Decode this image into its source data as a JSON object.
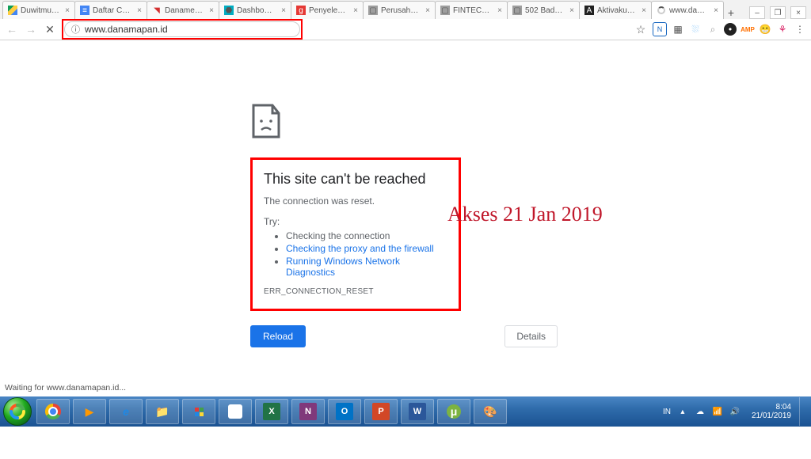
{
  "tabs": [
    {
      "title": "Duwitmu draf"
    },
    {
      "title": "Daftar Call Ce"
    },
    {
      "title": "Danamerdeka"
    },
    {
      "title": "Dashboard - A"
    },
    {
      "title": "Penyelenggar"
    },
    {
      "title": "Perusahaan Fi"
    },
    {
      "title": "FINTECH INDO"
    },
    {
      "title": "502 Bad Gate"
    },
    {
      "title": "Aktivaku Akti"
    },
    {
      "title": "www.danama"
    }
  ],
  "address_url": "www.danamapan.id",
  "error": {
    "heading": "This site can't be reached",
    "subtitle": "The connection was reset.",
    "try_label": "Try:",
    "items": {
      "check_conn": "Checking the connection",
      "check_proxy": "Checking the proxy and the firewall",
      "run_diag": "Running Windows Network Diagnostics"
    },
    "code": "ERR_CONNECTION_RESET",
    "reload": "Reload",
    "details": "Details"
  },
  "annotation": "Akses 21 Jan 2019",
  "status_bar": "Waiting for www.danamapan.id...",
  "tray": {
    "lang": "IN",
    "time": "8:04",
    "date": "21/01/2019"
  }
}
